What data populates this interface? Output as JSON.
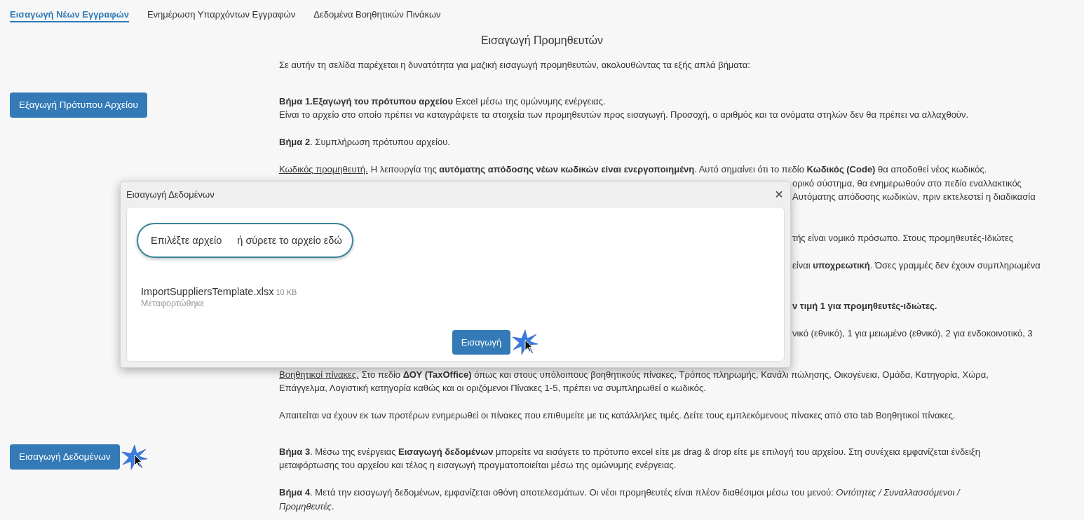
{
  "tabs": [
    {
      "label": "Εισαγωγή Νέων Εγγραφών",
      "selected": true
    },
    {
      "label": "Ενημέρωση Υπαρχόντων Εγγραφών",
      "selected": false
    },
    {
      "label": "Δεδομένα Βοηθητικών Πινάκων",
      "selected": false
    }
  ],
  "page_title": "Εισαγωγή Προμηθευτών",
  "sections": [
    {
      "kind": "plain",
      "lines": [
        {
          "text": "Σε αυτήν τη σελίδα παρέχεται η δυνατότητα για μαζική εισαγωγή προμηθευτών, ακολουθώντας τα εξής απλά βήματα:",
          "covered": false
        }
      ]
    },
    {
      "kind": "plain",
      "button": {
        "label": "Εξαγωγή Πρότυπου Αρχείου"
      },
      "lines": [
        {
          "text": "**Βήμα 1.Εξαγωγή του πρότυπου αρχείου** Excel μέσω της ομώνυμης ενέργειας.",
          "covered": false
        },
        {
          "text": "Είναι το αρχείο στο οποίο πρέπει να καταγράψετε τα στοιχεία των προμηθευτών προς εισαγωγή. Προσοχή, ο αριθμός και τα ονόματα στηλών δεν θα πρέπει να αλλαχθούν.",
          "covered": false
        }
      ]
    },
    {
      "kind": "plain",
      "lines": [
        {
          "text": "**Βήμα 2**. Συμπλήρωση πρότυπου αρχείου.",
          "covered": false
        }
      ]
    },
    {
      "kind": "partly_covered",
      "term": "Κωδικός προμηθευτή.",
      "lines": [
        {
          "text": "Η λειτουργία της **αυτόματης απόδοσης νέων κωδικών είναι ενεργοποιημένη**. Αυτό σημαίνει ότι το πεδίο **Κωδικός (Code)**  θα αποδοθεί νέος κωδικός.",
          "covered": false
        },
        {
          "text": "ορικό σύστημα, θα ενημερωθούν στο πεδίο εναλλακτικός",
          "covered": true
        },
        {
          "text": "Αυτόματης απόδοσης κωδικών, πριν εκτελεστεί η διαδικασία",
          "covered": true
        }
      ]
    },
    {
      "kind": "plain",
      "lines": [
        {
          "text": "τής είναι νομικό πρόσωπο. Στους προμηθευτές-Ιδιώτες",
          "covered": true
        }
      ]
    },
    {
      "kind": "partly_covered",
      "lines": [
        {
          "text": "είναι **υποχρεωτική**. Όσες γραμμές δεν έχουν συμπληρωμένα",
          "covered": true
        }
      ]
    },
    {
      "kind": "plain",
      "lines": [
        {
          "text": "ν τιμή 1 για προμηθευτές-ιδιώτες.",
          "covered": true,
          "bold": true
        }
      ]
    },
    {
      "kind": "partly_covered",
      "lines": [
        {
          "text": "νικό (εθνικό), 1 για μειωμένο (εθνικό), 2 για ενδοκοινοτικό, 3",
          "covered": true
        }
      ]
    },
    {
      "kind": "plain",
      "term": "Βοηθητικοί πίνακες.",
      "lines": [
        {
          "text": "Στο πεδίο **ΔΟΥ (TaxOffice)** όπως και στους υπόλοιπους βοηθητικούς πίνακες, Τρόπος πληρωμής, Κανάλι πώλησης, Οικογένεια, Ομάδα, Κατηγορία, Χώρα,",
          "covered": false
        },
        {
          "text": "Επάγγελμα, Λογιστική κατηγορία καθώς και οι οριζόμενοι Πίνακες 1-5, πρέπει να συμπληρωθεί ο κωδικός.",
          "covered": false
        }
      ]
    },
    {
      "kind": "plain",
      "lines": [
        {
          "text": "Απαιτείται να έχουν εκ των προτέρων ενημερωθεί οι πίνακες που επιθυμείτε με τις κατάλληλες τιμές. Δείτε τους εμπλεκόμενους πίνακες από στο tab Βοηθητικοί πίνακες.",
          "covered": false
        }
      ]
    },
    {
      "kind": "plain",
      "button": {
        "label": "Εισαγωγή Δεδομένων",
        "clicked": true
      },
      "lines": [
        {
          "text": "**Βήμα 3**. Μέσω της ενέργειας **Εισαγωγή δεδομένων** μπορείτε να εισάγετε το πρότυπο excel είτε με drag & drop είτε με επιλογή του αρχείου. Στη συνέχεια εμφανίζεται ένδειξη",
          "covered": false
        },
        {
          "text": "μεταφόρτωσης του αρχείου και τέλος η εισαγωγή πραγματοποιείται μέσω της ομώνυμης ενέργειας.",
          "covered": false
        }
      ]
    },
    {
      "kind": "plain",
      "lines": [
        {
          "text": "**Βήμα 4**. Μετά την εισαγωγή δεδομένων, εμφανίζεται οθόνη αποτελεσμάτων.  Οι νέοι προμηθευτές είναι πλέον διαθέσιμοι μέσω του μενού: *Οντότητες / Συναλλασσόμενοι /*",
          "covered": false
        },
        {
          "text": "*Προμηθευτές*.",
          "covered": false
        }
      ]
    }
  ],
  "dialog": {
    "title": "Εισαγωγή Δεδομένων",
    "close": "×",
    "upload": {
      "button": "Επιλέξτε αρχείο",
      "hint": "ή σύρετε το αρχείο εδώ"
    },
    "file": {
      "name": "ImportSuppliersTemplate.xlsx",
      "size": "10 KB",
      "status": "Μεταφορτώθηκε"
    },
    "action": {
      "label": "Εισαγωγή",
      "clicked": true
    }
  }
}
